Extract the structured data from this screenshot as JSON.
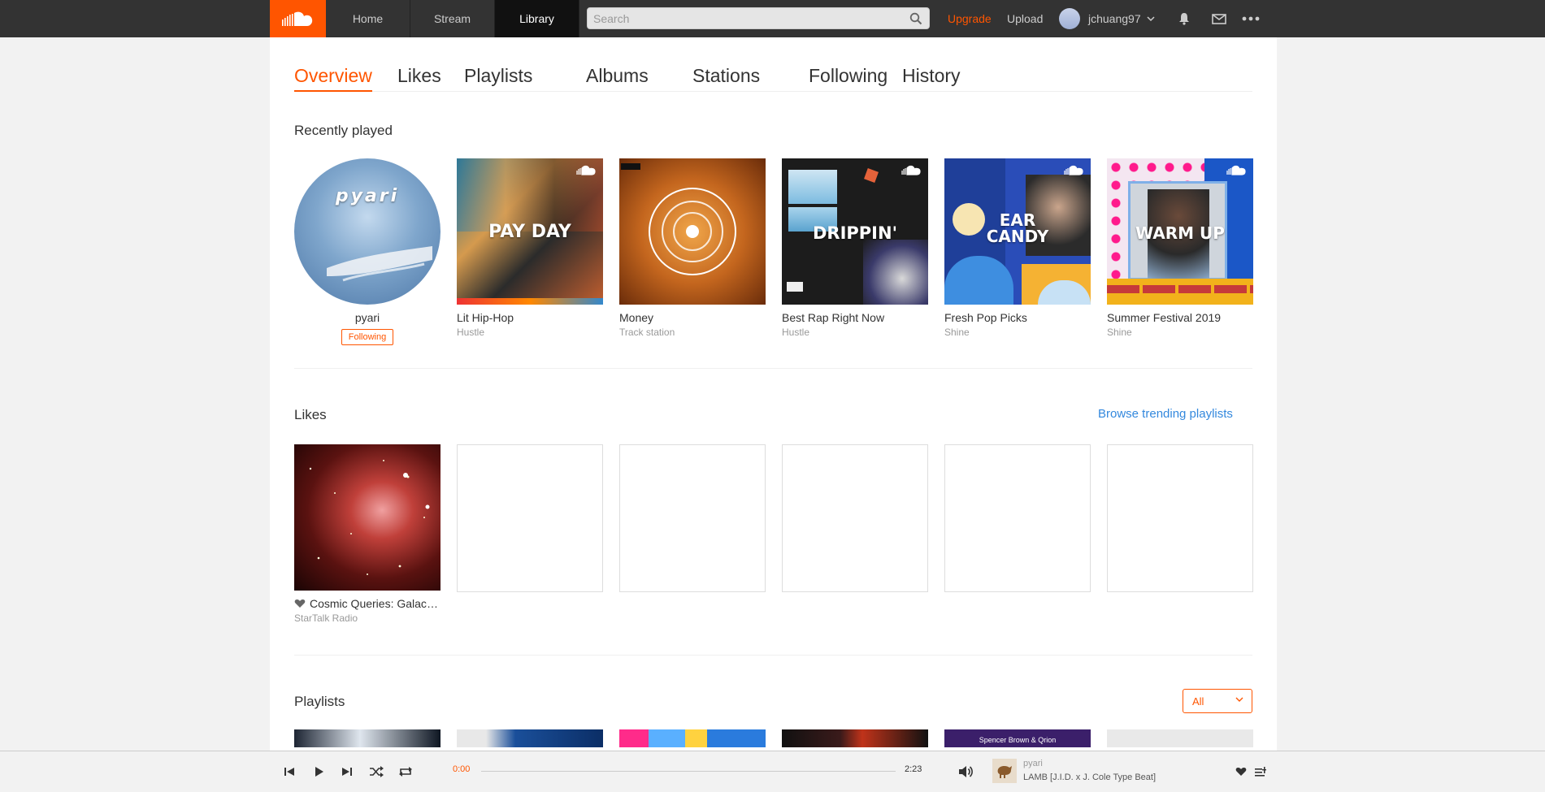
{
  "header": {
    "nav": [
      "Home",
      "Stream",
      "Library"
    ],
    "search_placeholder": "Search",
    "upgrade": "Upgrade",
    "upload": "Upload",
    "username": "jchuang97"
  },
  "tabs": [
    "Overview",
    "Likes",
    "Playlists",
    "Albums",
    "Stations",
    "Following",
    "History"
  ],
  "recently_played": {
    "title": "Recently played",
    "items": [
      {
        "title": "pyari",
        "sub": "",
        "art_text": "pyari",
        "button": "Following"
      },
      {
        "title": "Lit Hip-Hop",
        "sub": "Hustle",
        "art_text": "PAY DAY"
      },
      {
        "title": "Money",
        "sub": "Track station",
        "art_text": ""
      },
      {
        "title": "Best Rap Right Now",
        "sub": "Hustle",
        "art_text": "DRIPPIN'"
      },
      {
        "title": "Fresh Pop Picks",
        "sub": "Shine",
        "art_text": "EAR CANDY"
      },
      {
        "title": "Summer Festival 2019",
        "sub": "Shine",
        "art_text": "WARM UP"
      }
    ]
  },
  "likes": {
    "title": "Likes",
    "browse_link": "Browse trending playlists",
    "items": [
      {
        "title": "Cosmic Queries: Galacti...",
        "sub": "StarTalk Radio"
      }
    ]
  },
  "playlists": {
    "title": "Playlists",
    "filter": "All",
    "peek_text": "Spencer Brown & Qrion"
  },
  "player": {
    "elapsed": "0:00",
    "duration": "2:23",
    "progress": 0,
    "artist": "pyari",
    "track": "LAMB [J.I.D. x J. Cole Type Beat]"
  },
  "colors": {
    "accent": "#ff5500",
    "header": "#333333",
    "link": "#3388dd"
  }
}
